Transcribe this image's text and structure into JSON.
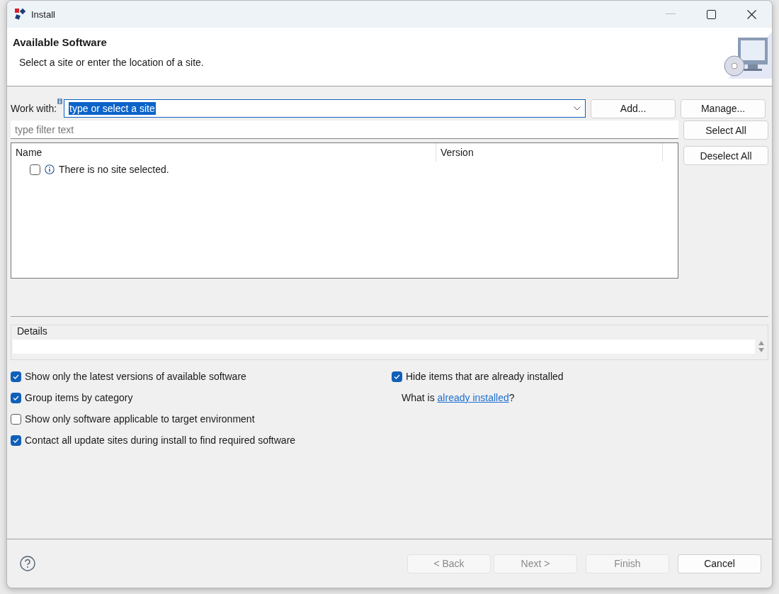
{
  "window": {
    "title": "Install"
  },
  "header": {
    "title": "Available Software",
    "description": "Select a site or enter the location of a site."
  },
  "work_with": {
    "label": "Work with:",
    "value": "type or select a site",
    "value_selected": true
  },
  "site_buttons": [
    {
      "label": "Add..."
    },
    {
      "label": "Manage..."
    }
  ],
  "filter": {
    "placeholder": "type filter text"
  },
  "table": {
    "columns": [
      "Name",
      "Version"
    ],
    "rows": [
      {
        "text": "There is no site selected.",
        "checked": false
      }
    ]
  },
  "side_buttons": [
    {
      "label": "Select All"
    },
    {
      "label": "Deselect All"
    }
  ],
  "details": {
    "label": "Details"
  },
  "options_left": [
    {
      "label": "Show only the latest versions of available software",
      "checked": true
    },
    {
      "label": "Group items by category",
      "checked": true
    },
    {
      "label": "Show only software applicable to target environment",
      "checked": false
    },
    {
      "label": "Contact all update sites during install to find required software",
      "checked": true
    }
  ],
  "options_right": [
    {
      "label": "Hide items that are already installed",
      "checked": true
    }
  ],
  "installed_link": {
    "prefix": "What is ",
    "link": "already installed",
    "suffix": "?"
  },
  "footer_buttons": [
    {
      "label": "< Back",
      "disabled": true
    },
    {
      "label": "Next >",
      "disabled": true
    },
    {
      "label": "Finish",
      "disabled": true
    },
    {
      "label": "Cancel",
      "disabled": false
    }
  ]
}
